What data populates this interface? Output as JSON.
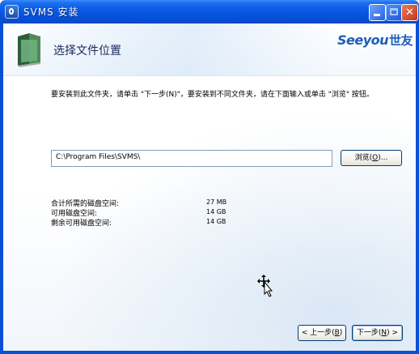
{
  "window": {
    "title": "SVMS 安装",
    "controls": {
      "minimize": "minimize",
      "maximize": "maximize",
      "close": "close"
    }
  },
  "header": {
    "title": "选择文件位置",
    "logo_text": "Seeyou",
    "logo_cn": "世友",
    "icon": "folder-icon"
  },
  "main": {
    "instructions": "要安装到此文件夹，请单击 \"下一步(N)\"，要安装到不同文件夹，请在下面输入或单击 \"浏览\" 按钮。",
    "install_path": "C:\\Program Files\\SVMS\\",
    "browse_label": "浏览(O)...",
    "browse_pre": "浏览(",
    "browse_key": "O",
    "browse_post": ")...",
    "space": [
      {
        "label": "合计所需的磁盘空间:",
        "value": "27 MB"
      },
      {
        "label": "可用磁盘空间:",
        "value": "14 GB"
      },
      {
        "label": "剩余可用磁盘空间:",
        "value": "14 GB"
      }
    ]
  },
  "footer": {
    "back_pre": "< 上一步(",
    "back_key": "B",
    "back_post": ")",
    "next_pre": "下一步(",
    "next_key": "N",
    "next_post": ") >"
  },
  "colors": {
    "titlebar": "#0a5ce8",
    "logo": "#1d5db8",
    "border": "#0a4fd6"
  }
}
